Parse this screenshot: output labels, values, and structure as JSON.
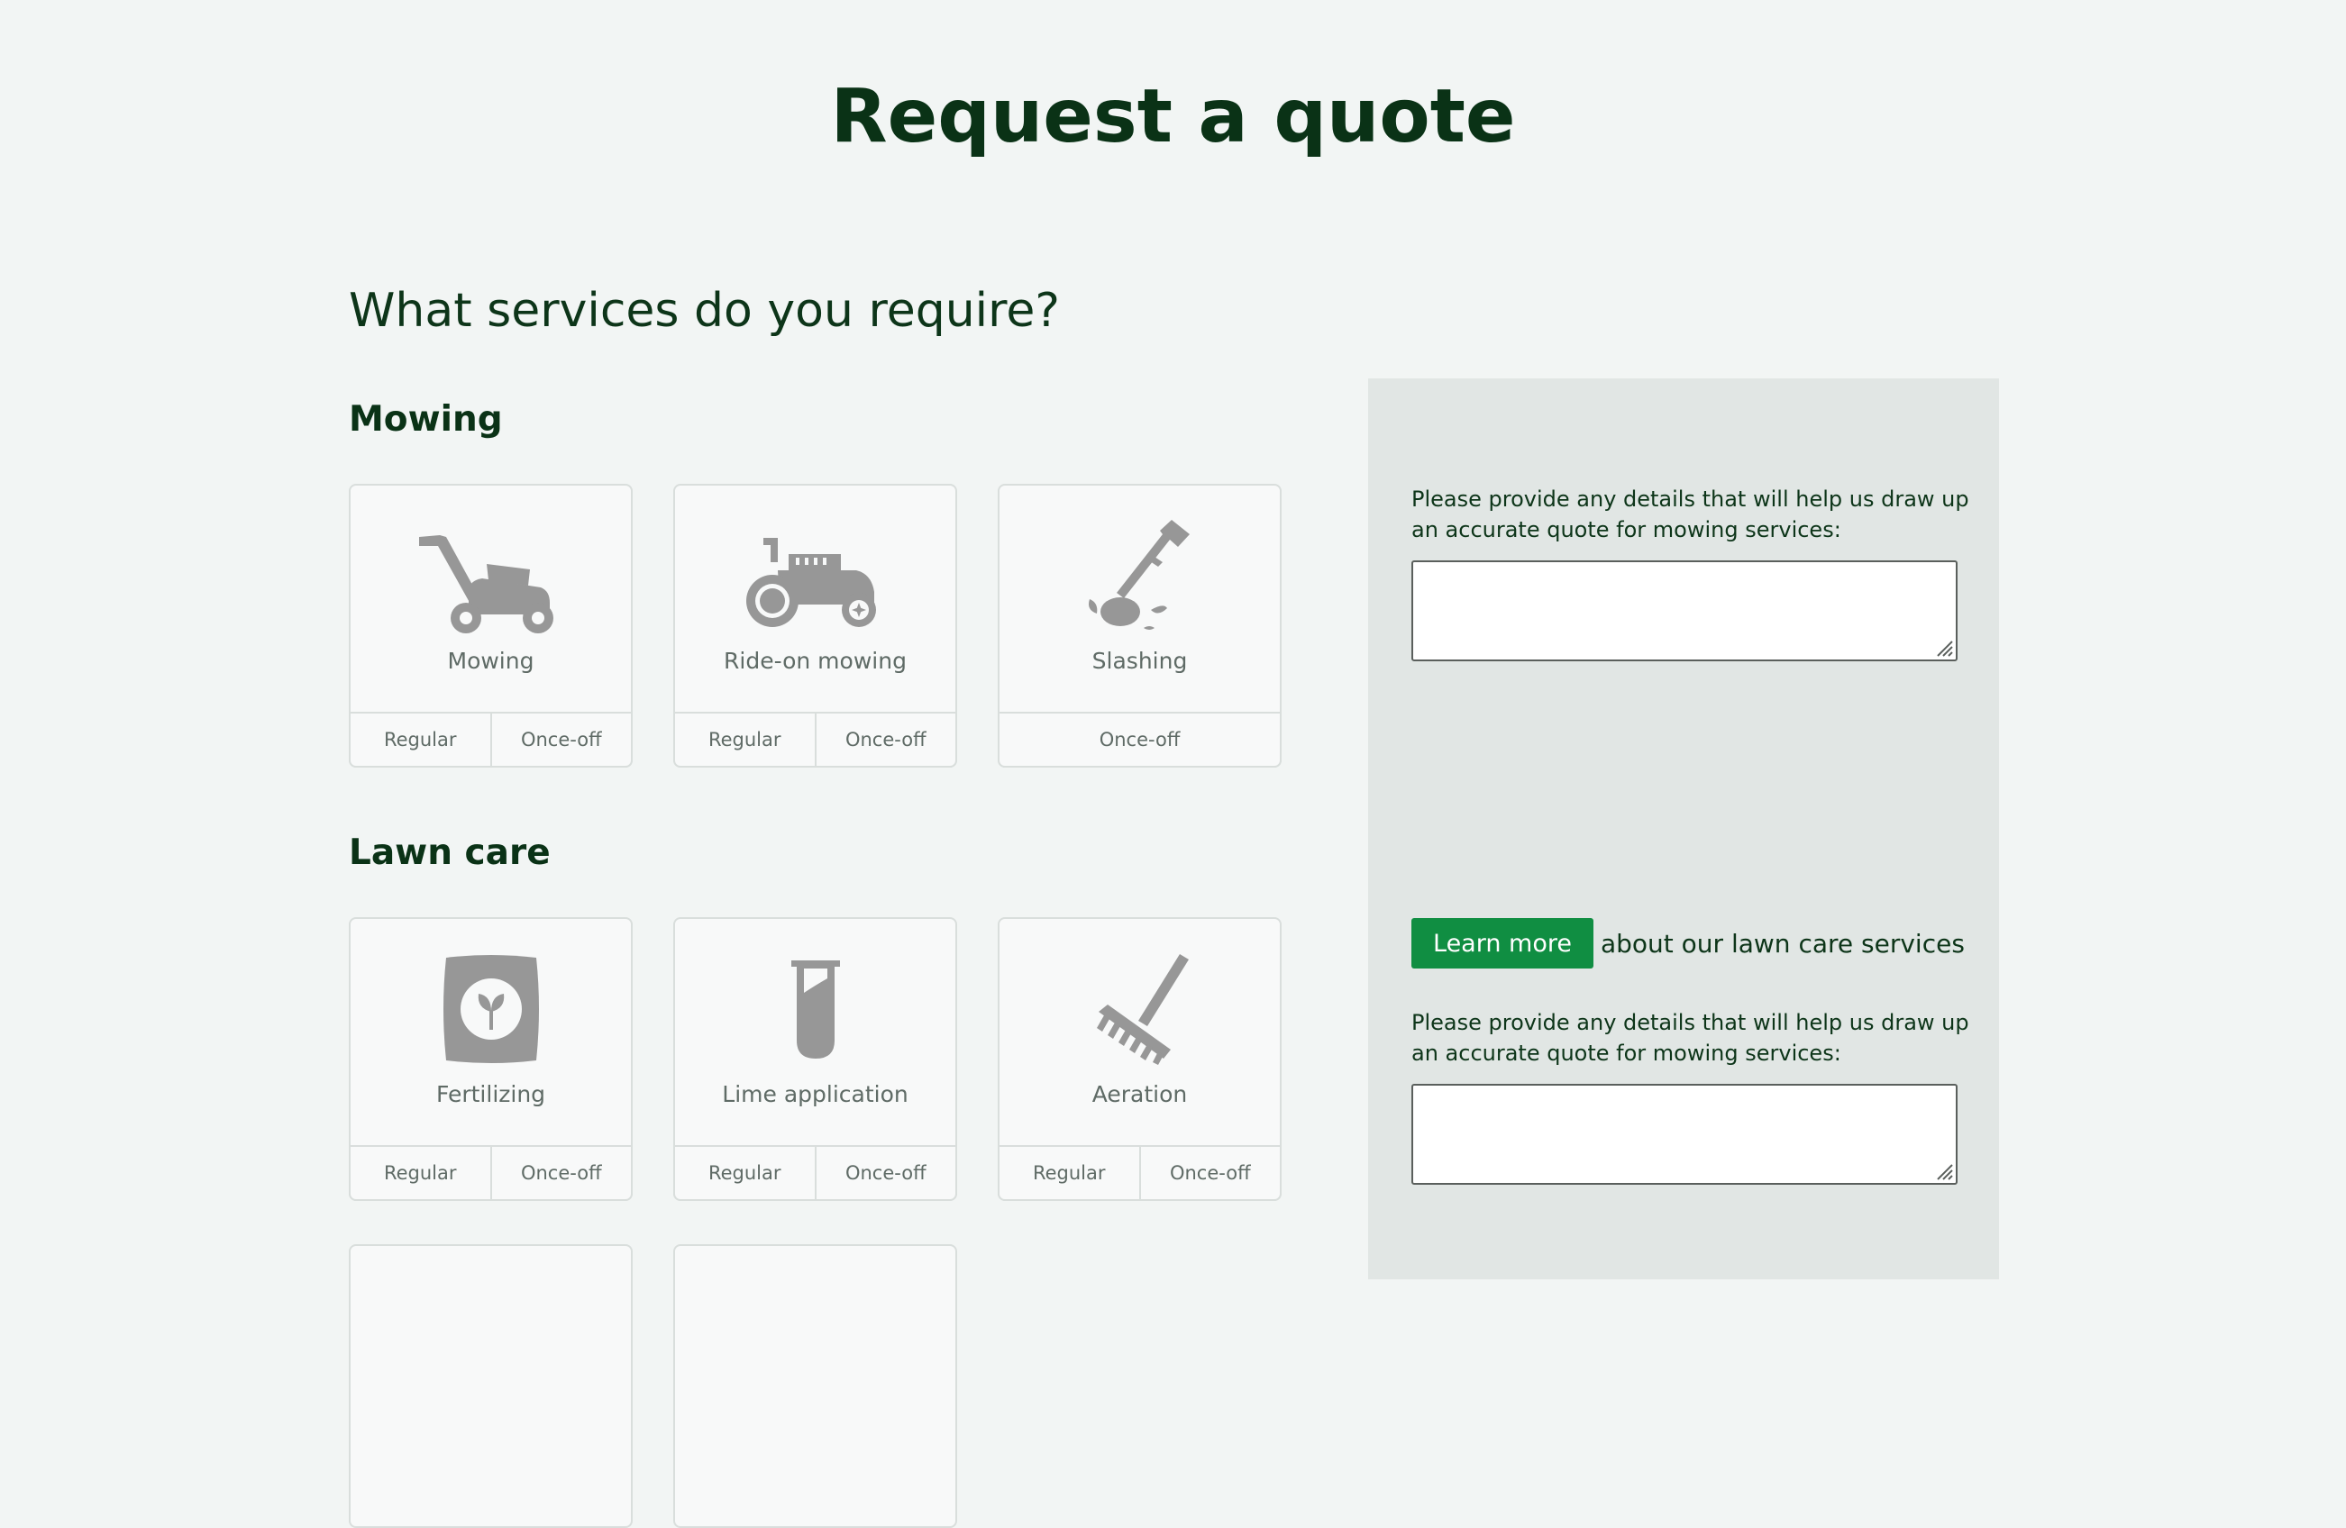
{
  "page": {
    "title": "Request a quote"
  },
  "question": "What services do you require?",
  "sections": {
    "mowing": {
      "heading": "Mowing",
      "cards": [
        {
          "label": "Mowing",
          "icon": "lawn-mower-icon",
          "options": [
            "Regular",
            "Once-off"
          ]
        },
        {
          "label": "Ride-on mowing",
          "icon": "ride-on-mower-icon",
          "options": [
            "Regular",
            "Once-off"
          ]
        },
        {
          "label": "Slashing",
          "icon": "brush-cutter-icon",
          "options": [
            "Once-off"
          ]
        }
      ]
    },
    "lawn_care": {
      "heading": "Lawn care",
      "cards": [
        {
          "label": "Fertilizing",
          "icon": "fertilizer-bag-icon",
          "options": [
            "Regular",
            "Once-off"
          ]
        },
        {
          "label": "Lime application",
          "icon": "test-tube-icon",
          "options": [
            "Regular",
            "Once-off"
          ]
        },
        {
          "label": "Aeration",
          "icon": "aerator-rake-icon",
          "options": [
            "Regular",
            "Once-off"
          ]
        }
      ]
    }
  },
  "panel": {
    "mowing_prompt": "Please provide any details that will help us draw up an accurate quote for mowing services:",
    "learn_more_label": "Learn more",
    "learn_more_text": "about our lawn care services",
    "lawn_prompt": "Please provide any details that will help us draw up an accurate quote for mowing services:"
  },
  "colors": {
    "background": "#f2f5f4",
    "panel": "#e1e6e4",
    "heading": "#0a3216",
    "accent": "#108e42",
    "icon": "#979797"
  }
}
